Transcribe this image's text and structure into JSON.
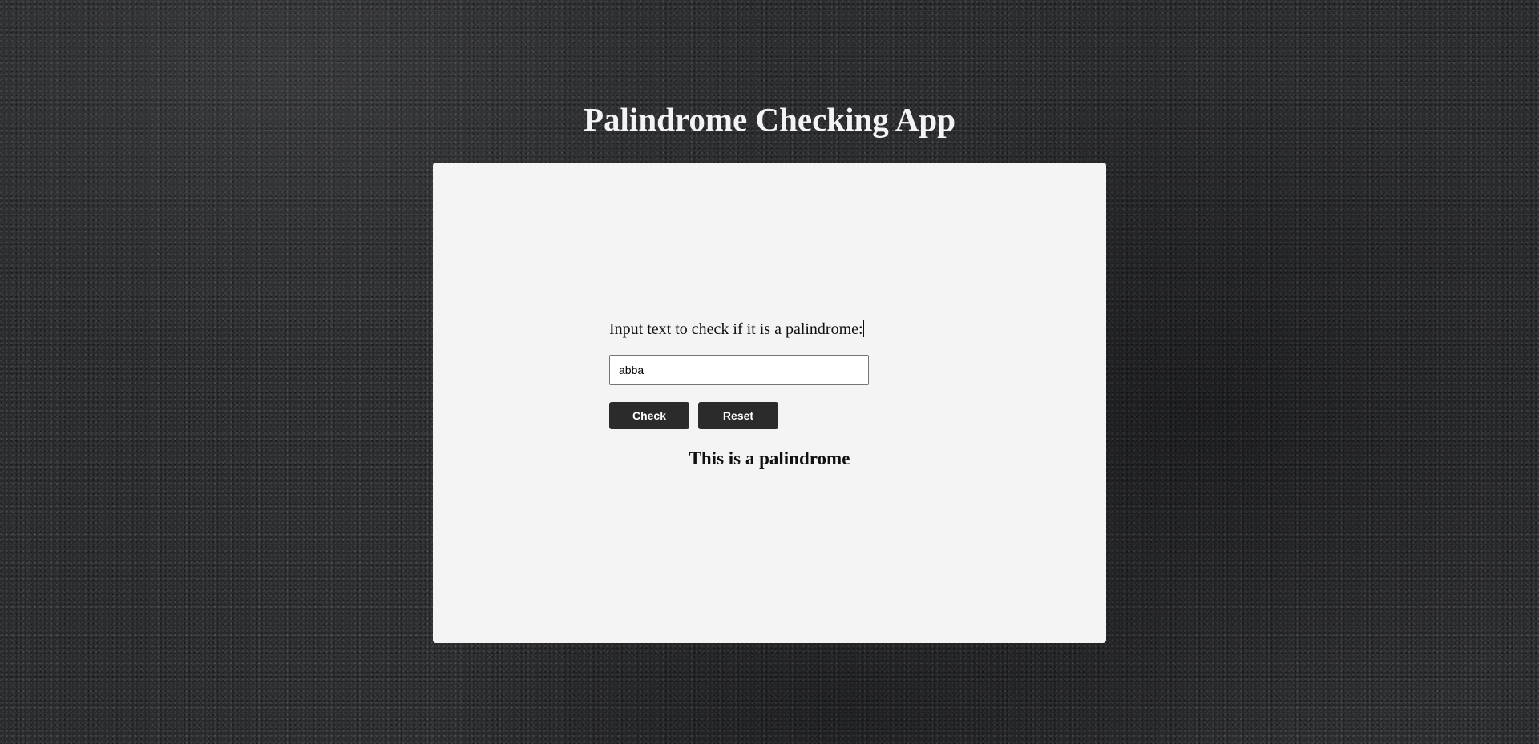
{
  "app": {
    "title": "Palindrome Checking App"
  },
  "form": {
    "prompt_label": "Input text to check if it is a palindrome:",
    "input_value": "abba",
    "check_label": "Check",
    "reset_label": "Reset"
  },
  "result": {
    "text": "This is a palindrome"
  },
  "colors": {
    "card_background": "#f4f4f4",
    "button_background": "#2b2b2b",
    "title_color": "#f3f3f7"
  }
}
